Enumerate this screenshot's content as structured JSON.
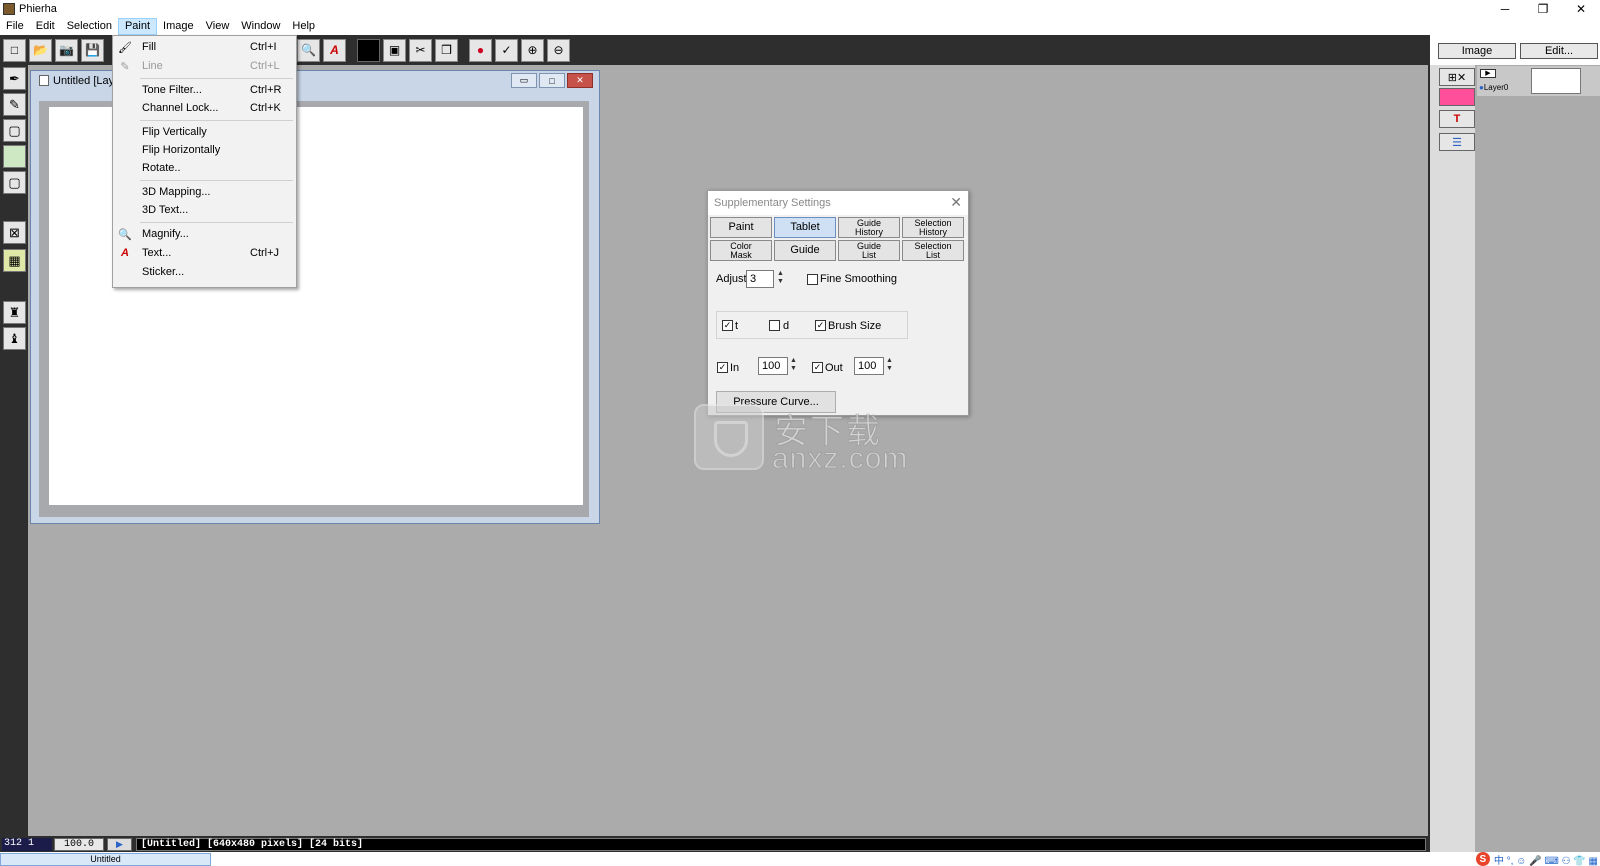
{
  "app": {
    "title": "Phierha",
    "window_controls": [
      "─",
      "❐",
      "✕"
    ]
  },
  "menubar": {
    "items": [
      "File",
      "Edit",
      "Selection",
      "Paint",
      "Image",
      "View",
      "Window",
      "Help"
    ],
    "active": "Paint"
  },
  "paint_menu": {
    "items": [
      {
        "label": "Fill",
        "shortcut": "Ctrl+I",
        "icon": "fill-icon",
        "glyph": "🖌"
      },
      {
        "label": "Line",
        "shortcut": "Ctrl+L",
        "icon": "line-icon",
        "glyph": "✎",
        "disabled": true
      },
      {
        "label": "Tone Filter...",
        "shortcut": "Ctrl+R"
      },
      {
        "label": "Channel Lock...",
        "shortcut": "Ctrl+K"
      },
      {
        "label": "Flip Vertically",
        "shortcut": ""
      },
      {
        "label": "Flip Horizontally",
        "shortcut": ""
      },
      {
        "label": "Rotate..",
        "shortcut": ""
      },
      {
        "label": "3D Mapping...",
        "shortcut": ""
      },
      {
        "label": "3D Text...",
        "shortcut": ""
      },
      {
        "label": "Magnify...",
        "shortcut": "",
        "icon": "magnify-icon",
        "glyph": "🔍"
      },
      {
        "label": "Text...",
        "shortcut": "Ctrl+J",
        "icon": "text-icon",
        "glyph": "A"
      },
      {
        "label": "Sticker...",
        "shortcut": ""
      }
    ]
  },
  "canvas_window": {
    "title": "Untitled [Lay",
    "buttons": [
      "▭",
      "□",
      "✕"
    ]
  },
  "supplementary": {
    "title": "Supplementary Settings",
    "close": "✕",
    "tabs": [
      {
        "label": "Paint",
        "lines": [
          "Paint"
        ]
      },
      {
        "label": "Tablet",
        "lines": [
          "Tablet"
        ],
        "active": true
      },
      {
        "label": "Guide History",
        "lines": [
          "Guide",
          "History"
        ]
      },
      {
        "label": "Selection History",
        "lines": [
          "Selection",
          "History"
        ]
      },
      {
        "label": "Color Mask",
        "lines": [
          "Color",
          "Mask"
        ]
      },
      {
        "label": "Guide",
        "lines": [
          "Guide"
        ]
      },
      {
        "label": "Guide List",
        "lines": [
          "Guide",
          "List"
        ]
      },
      {
        "label": "Selection List",
        "lines": [
          "Selection",
          "List"
        ]
      }
    ],
    "adjust_label": "Adjust",
    "adjust_value": "3",
    "fine_smoothing_label": "Fine Smoothing",
    "fine_smoothing_checked": false,
    "t_label": "t",
    "t_checked": true,
    "d_label": "d",
    "d_checked": false,
    "brush_size_label": "Brush Size",
    "brush_size_checked": true,
    "in_label": "In",
    "in_checked": true,
    "in_value": "100",
    "out_label": "Out",
    "out_checked": true,
    "out_value": "100",
    "pressure_button": "Pressure Curve..."
  },
  "watermark": {
    "cn": "安下载",
    "site": "anxz.com"
  },
  "right_panel": {
    "image_button": "Image",
    "edit_button": "Edit...",
    "layer_name": "Layer0",
    "layer_color": "#ff4f9a"
  },
  "status": {
    "coord": "312 1",
    "zoom": "100.0",
    "play": "▶",
    "info": "[Untitled] [640x480 pixels] [24 bits]"
  },
  "taskbar": {
    "item": "Untitled",
    "tray_logo": "S",
    "tray_icons": "中 °, ☺ 🎤 ⌨ ⚇ 👕 ▦"
  }
}
